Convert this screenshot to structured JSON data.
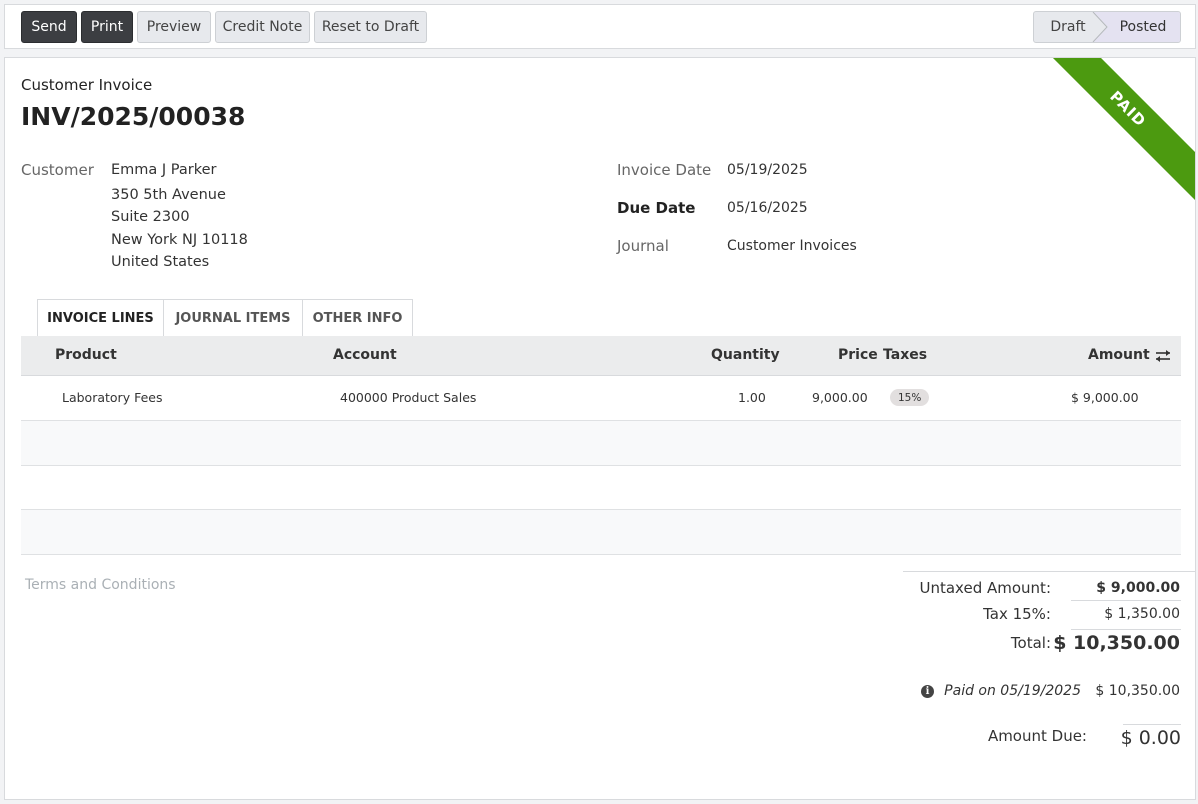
{
  "toolbar": {
    "send": "Send",
    "print": "Print",
    "preview": "Preview",
    "credit_note": "Credit Note",
    "reset_to_draft": "Reset to Draft"
  },
  "status": {
    "draft": "Draft",
    "posted": "Posted",
    "active": "Posted"
  },
  "ribbon": "PAID",
  "invoice": {
    "type": "Customer Invoice",
    "number": "INV/2025/00038",
    "customer_label": "Customer",
    "customer_name": "Emma J Parker",
    "address": [
      "350 5th Avenue",
      "Suite 2300",
      "New York NJ 10118",
      "United States"
    ],
    "invoice_date_label": "Invoice Date",
    "invoice_date": "05/19/2025",
    "due_date_label": "Due Date",
    "due_date": "05/16/2025",
    "journal_label": "Journal",
    "journal": "Customer Invoices"
  },
  "tabs": [
    "INVOICE LINES",
    "JOURNAL ITEMS",
    "OTHER INFO"
  ],
  "table": {
    "headers": {
      "product": "Product",
      "account": "Account",
      "quantity": "Quantity",
      "price": "Price",
      "taxes": "Taxes",
      "amount": "Amount"
    },
    "rows": [
      {
        "product": "Laboratory Fees",
        "account": "400000 Product Sales",
        "quantity": "1.00",
        "price": "9,000.00",
        "tax": "15%",
        "amount": "$ 9,000.00"
      }
    ]
  },
  "terms_placeholder": "Terms and Conditions",
  "totals": {
    "untaxed_label": "Untaxed Amount:",
    "untaxed": "$ 9,000.00",
    "tax_label": "Tax 15%:",
    "tax": "$ 1,350.00",
    "total_label": "Total:",
    "total": "$ 10,350.00",
    "paid_label": "Paid on 05/19/2025",
    "paid": "$ 10,350.00",
    "due_label": "Amount Due:",
    "due": "$ 0.00"
  },
  "colors": {
    "ribbon": "#4c9a10",
    "dark_button": "#3c3e42"
  }
}
